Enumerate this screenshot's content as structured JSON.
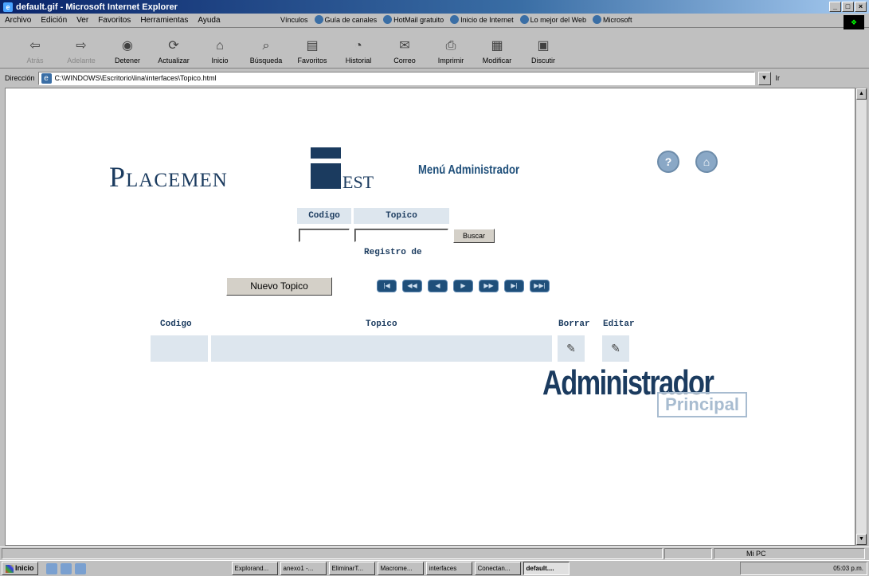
{
  "window": {
    "title": "default.gif - Microsoft Internet Explorer"
  },
  "menu": [
    "Archivo",
    "Edición",
    "Ver",
    "Favoritos",
    "Herramientas",
    "Ayuda"
  ],
  "links": {
    "label": "Vínculos",
    "items": [
      "Guía de canales",
      "HotMail gratuito",
      "Inicio de Internet",
      "Lo mejor del Web",
      "Microsoft"
    ]
  },
  "toolbar": [
    {
      "label": "Atrás",
      "icon": "back-arrow-icon",
      "enabled": false
    },
    {
      "label": "Adelante",
      "icon": "forward-arrow-icon",
      "enabled": false
    },
    {
      "label": "Detener",
      "icon": "stop-icon",
      "enabled": true
    },
    {
      "label": "Actualizar",
      "icon": "refresh-icon",
      "enabled": true
    },
    {
      "label": "Inicio",
      "icon": "home-icon",
      "enabled": true
    },
    {
      "label": "Búsqueda",
      "icon": "search-icon",
      "enabled": true
    },
    {
      "label": "Favoritos",
      "icon": "favorites-icon",
      "enabled": true
    },
    {
      "label": "Historial",
      "icon": "history-icon",
      "enabled": true
    },
    {
      "label": "Correo",
      "icon": "mail-icon",
      "enabled": true
    },
    {
      "label": "Imprimir",
      "icon": "print-icon",
      "enabled": true
    },
    {
      "label": "Modificar",
      "icon": "edit-icon",
      "enabled": true
    },
    {
      "label": "Discutir",
      "icon": "discuss-icon",
      "enabled": true
    }
  ],
  "address": {
    "label": "Dirección",
    "value": "C:\\WINDOWS\\Escritorio\\lina\\interfaces\\Topico.html",
    "go": "Ir"
  },
  "page": {
    "logo_word": "Placemen",
    "logo_tail": "est",
    "menu_title": "Menú Administrador",
    "help_icon": "help-icon",
    "home_icon": "home-icon",
    "search": {
      "col1": "Codigo",
      "col2": "Topico",
      "button": "Buscar"
    },
    "registro": "Registro de",
    "new_button": "Nuevo Topico",
    "nav_buttons": [
      "first-icon",
      "prev-page-icon",
      "prev-icon",
      "next-icon",
      "next-page-icon",
      "last-page-icon",
      "last-icon"
    ],
    "list": {
      "codigo": "Codigo",
      "topico": "Topico",
      "borrar": "Borrar",
      "editar": "Editar"
    },
    "brand_big": "Administrador",
    "brand_small": "Principal"
  },
  "status": {
    "zone": "Mi PC"
  },
  "taskbar": {
    "start": "Inicio",
    "tasks": [
      "Explorand...",
      "anexo1 -...",
      "EliminarT...",
      "Macrome...",
      "interfaces",
      "Conectan...",
      "default...."
    ],
    "clock": "05:03 p.m."
  }
}
